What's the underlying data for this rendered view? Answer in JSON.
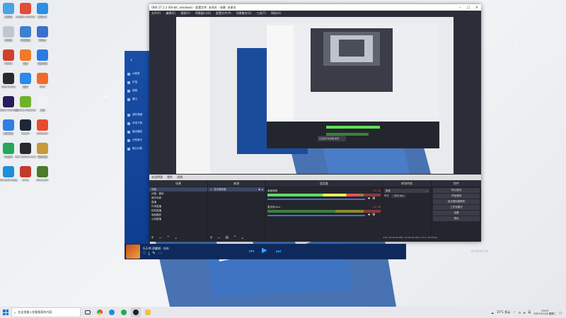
{
  "desktop_icons": [
    {
      "label": "此电脑",
      "color": "#4aa3e8"
    },
    {
      "label": "Google Chrome",
      "color": "#e34b3a"
    },
    {
      "label": "腾讯QQ",
      "color": "#2a8fe6"
    },
    {
      "label": "回收站",
      "color": "#bfc7d2"
    },
    {
      "label": "控制面板",
      "color": "#3f7fd0"
    },
    {
      "label": "网易云",
      "color": "#3b6fc9"
    },
    {
      "label": "Adobe",
      "color": "#d1402c"
    },
    {
      "label": "迅雷",
      "color": "#f07a2a"
    },
    {
      "label": "百度网盘",
      "color": "#2d7ae5"
    },
    {
      "label": "OBS Studio",
      "color": "#2a2a2a"
    },
    {
      "label": "酷狗",
      "color": "#2e89e8"
    },
    {
      "label": "WPS",
      "color": "#f06b2a"
    },
    {
      "label": "Adobe Premiere",
      "color": "#2a1b5c"
    },
    {
      "label": "GeForce Experience",
      "color": "#6fb32a"
    },
    {
      "label": "文档",
      "color": "#f2f2f2"
    },
    {
      "label": "腾讯会议",
      "color": "#2f7ee8"
    },
    {
      "label": "Steam",
      "color": "#1b2838"
    },
    {
      "label": "WeGame",
      "color": "#e84a2e"
    },
    {
      "label": "QQ音乐",
      "color": "#27a65c"
    },
    {
      "label": "Epic Games Launcher",
      "color": "#2a2a2a"
    },
    {
      "label": "英雄联盟",
      "color": "#c49a3a"
    },
    {
      "label": "Microsoft Edge",
      "color": "#1f8fd8"
    },
    {
      "label": "Arma",
      "color": "#c43a2a"
    },
    {
      "label": "Minecraft",
      "color": "#4a7a2a"
    }
  ],
  "player": {
    "back_icon": "chevron-left-icon",
    "nav_items": [
      "AI推荐",
      "乐馆",
      "视频",
      "雷达",
      "我的收藏",
      "本地下载",
      "最近播放",
      "已购音乐",
      "默认列表"
    ],
    "track_title": "G.E.M.邓紫棋 - 光年",
    "time": "00:00/03:14"
  },
  "obs": {
    "title": "OBS 27.1.3 (64-bit, windows) - 配置文件: 未命名 - 场景: 未命名",
    "menu": [
      "文件(F)",
      "编辑(E)",
      "视图(V)",
      "停靠窗口(D)",
      "配置文件(P)",
      "场景集合(S)",
      "工具(T)",
      "帮助(H)"
    ],
    "status_left": "未选择源",
    "status_buttons": [
      "属性",
      "滤镜"
    ],
    "docks": {
      "scenes_title": "场景",
      "sources_title": "来源",
      "mixer_title": "混音器",
      "transitions_title": "转场特效",
      "controls_title": "控件"
    },
    "scenes": [
      "场景",
      "AI图 - 播放",
      "娱乐场景",
      "直播",
      "外场直播",
      "相机直播",
      "画面播放",
      "公网直播"
    ],
    "sources": [
      "显示器采集"
    ],
    "mixer": [
      {
        "name": "桌面音频",
        "value": "0.0 dB",
        "level": 0.82
      },
      {
        "name": "麦克风/Aux",
        "value": "0.0 dB",
        "level": 0.0
      }
    ],
    "transition_label": "渐变",
    "duration_label": "时长",
    "duration_value": "300 ms",
    "controls": [
      "停止推流",
      "开始录制",
      "启动虚拟摄像机",
      "工作室模式",
      "设置",
      "退出"
    ],
    "footer": "LIVE: 00:00:00   REC: 00:00:00   CPU: 1.5%, 30.00 fps"
  },
  "nested_popup": "正在运行中直播-如何",
  "taskbar": {
    "search_placeholder": "在这里输入你要搜索的内容",
    "weather": "15°C 多云",
    "ime": "英",
    "time": "19:37",
    "date": "2021/11/16 星期二"
  }
}
